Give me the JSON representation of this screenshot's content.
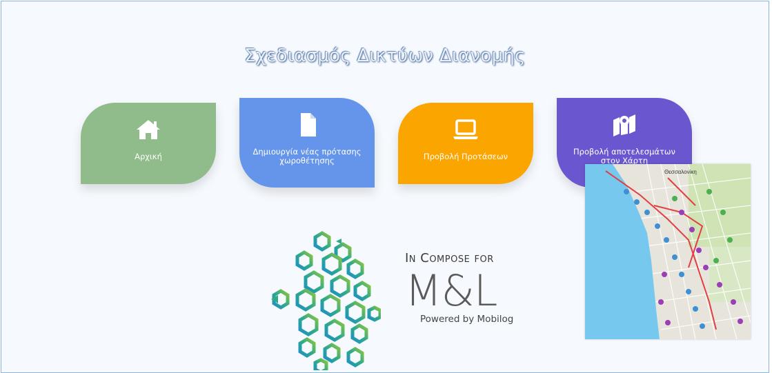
{
  "page": {
    "title": "Σχεδιασμός Δικτύων Διανομής"
  },
  "tiles": [
    {
      "label": "Αρχική",
      "icon": "home-icon",
      "color": "#8fbc8a"
    },
    {
      "label": "Δημιουργία νέας πρότασης χωροθέτησης",
      "icon": "document-icon",
      "color": "#6495ea"
    },
    {
      "label": "Προβολή Προτάσεων",
      "icon": "laptop-icon",
      "color": "#fba500"
    },
    {
      "label": "Προβολή αποτελεσμάτων στον Χάρτη",
      "icon": "map-marker-icon",
      "color": "#6a57cf"
    }
  ],
  "brand": {
    "line1": "In Compose for",
    "line2": "M&L",
    "line3": "Powered by Mobilog"
  },
  "map_preview": {
    "label": "Θεσσαλονίκη"
  }
}
